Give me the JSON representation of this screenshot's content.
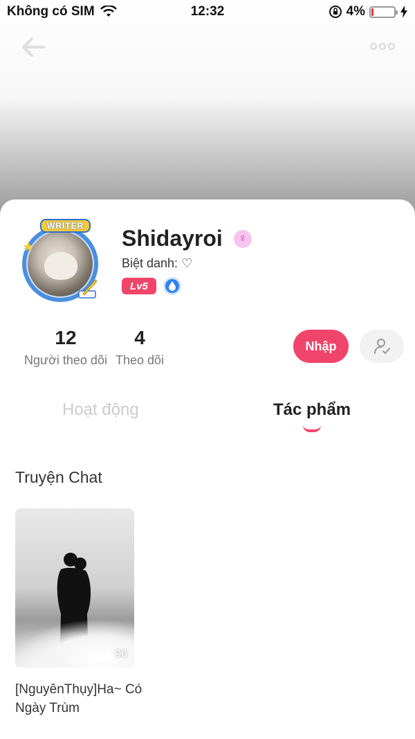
{
  "status_bar": {
    "carrier": "Không có SIM",
    "time": "12:32",
    "battery": "4%",
    "battery_level": 0.04,
    "icons": [
      "wifi-icon",
      "rotation-lock-icon",
      "charging-icon"
    ]
  },
  "header": {
    "back_icon": "back-arrow-icon",
    "more_icon": "more-icon"
  },
  "profile": {
    "avatar_badge": "WRITER",
    "username": "Shidayroi",
    "gender_icon": "female-icon",
    "nickname": "Biệt danh: ♡",
    "level": "Lv5",
    "vip_icon": "vip-badge-icon"
  },
  "stats": {
    "followers_count": "12",
    "followers_label": "Người theo dõi",
    "following_count": "4",
    "following_label": "Theo dõi"
  },
  "actions": {
    "import_label": "Nhập",
    "user_icon": "user-settings-icon"
  },
  "tabs": [
    {
      "label": "Hoạt động",
      "active": false
    },
    {
      "label": "Tác phẩm",
      "active": true
    }
  ],
  "section": {
    "title": "Truyện Chat"
  },
  "stories": [
    {
      "title": "[NguyênThụy]Ha~ Có Ngày Trùm",
      "likes": "90"
    }
  ],
  "colors": {
    "accent": "#f0456b",
    "vip_blue": "#2f80ed",
    "inactive_tab": "#cccccc"
  }
}
